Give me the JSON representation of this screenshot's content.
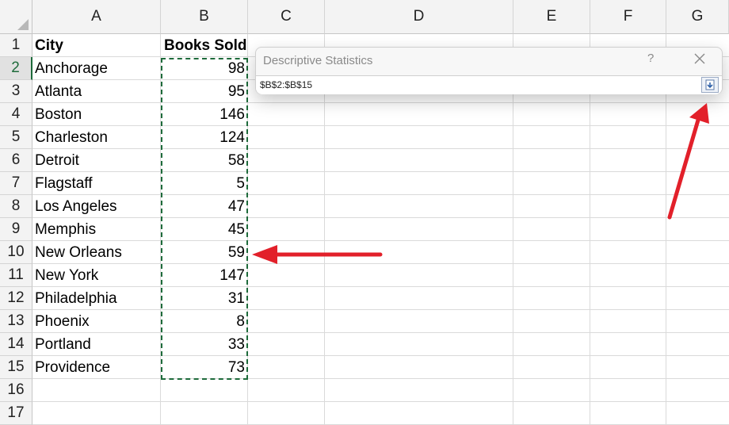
{
  "columns": [
    "A",
    "B",
    "C",
    "D",
    "E",
    "F",
    "G"
  ],
  "rows": [
    "1",
    "2",
    "3",
    "4",
    "5",
    "6",
    "7",
    "8",
    "9",
    "10",
    "11",
    "12",
    "13",
    "14",
    "15",
    "16",
    "17"
  ],
  "selected_row": "2",
  "header": {
    "city": "City",
    "books_sold": "Books Sold"
  },
  "data_rows": [
    {
      "city": "Anchorage",
      "books": "98"
    },
    {
      "city": "Atlanta",
      "books": "95"
    },
    {
      "city": "Boston",
      "books": "146"
    },
    {
      "city": "Charleston",
      "books": "124"
    },
    {
      "city": "Detroit",
      "books": "58"
    },
    {
      "city": "Flagstaff",
      "books": "5"
    },
    {
      "city": "Los Angeles",
      "books": "47"
    },
    {
      "city": "Memphis",
      "books": "45"
    },
    {
      "city": "New Orleans",
      "books": "59"
    },
    {
      "city": "New York",
      "books": "147"
    },
    {
      "city": "Philadelphia",
      "books": "31"
    },
    {
      "city": "Phoenix",
      "books": "8"
    },
    {
      "city": "Portland",
      "books": "33"
    },
    {
      "city": "Providence",
      "books": "73"
    }
  ],
  "dialog": {
    "title": "Descriptive Statistics",
    "help": "?",
    "range": "$B$2:$B$15"
  },
  "colors": {
    "selection": "#1e6b3b",
    "arrow": "#e2202a"
  },
  "icons": {
    "close": "close-icon",
    "expand": "expand-dialog-icon"
  }
}
